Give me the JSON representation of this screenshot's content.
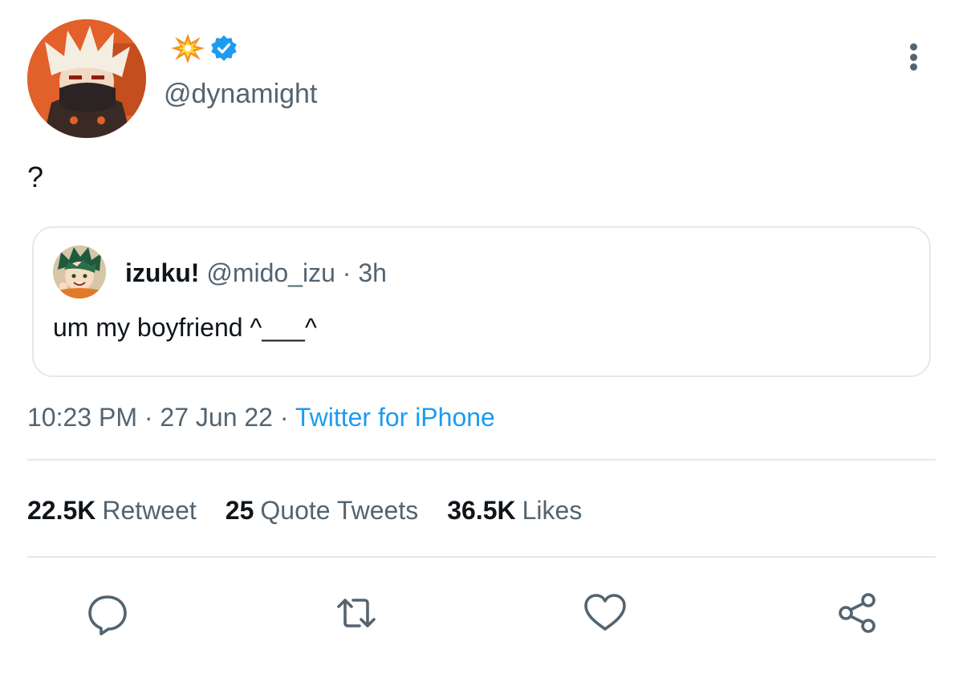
{
  "author": {
    "name_emoji": "💥",
    "handle": "@dynamight",
    "verified": true,
    "avatar_icon": "avatar-bakugo",
    "verified_icon": "verified-badge-icon",
    "verified_color": "#1d9bf0"
  },
  "tweet": {
    "text": "?"
  },
  "quoted": {
    "name": "izuku!",
    "handle": "@mido_izu",
    "separator": " · ",
    "time": "3h",
    "text": "um my boyfriend ^___^",
    "avatar_icon": "avatar-izuku"
  },
  "meta": {
    "time": "10:23 PM",
    "sep1": " · ",
    "date": "27 Jun 22",
    "sep2": " · ",
    "source": "Twitter for iPhone",
    "source_color": "#1d9bf0"
  },
  "stats": {
    "retweets": {
      "count": "22.5K",
      "label": "Retweet"
    },
    "quotes": {
      "count": "25",
      "label": "Quote Tweets"
    },
    "likes": {
      "count": "36.5K",
      "label": "Likes"
    }
  },
  "actions": [
    "reply-icon",
    "retweet-icon",
    "like-icon",
    "share-icon"
  ],
  "colors": {
    "text": "#0f1419",
    "secondary": "#536471",
    "accent": "#1d9bf0",
    "border": "#e4e9ed"
  }
}
